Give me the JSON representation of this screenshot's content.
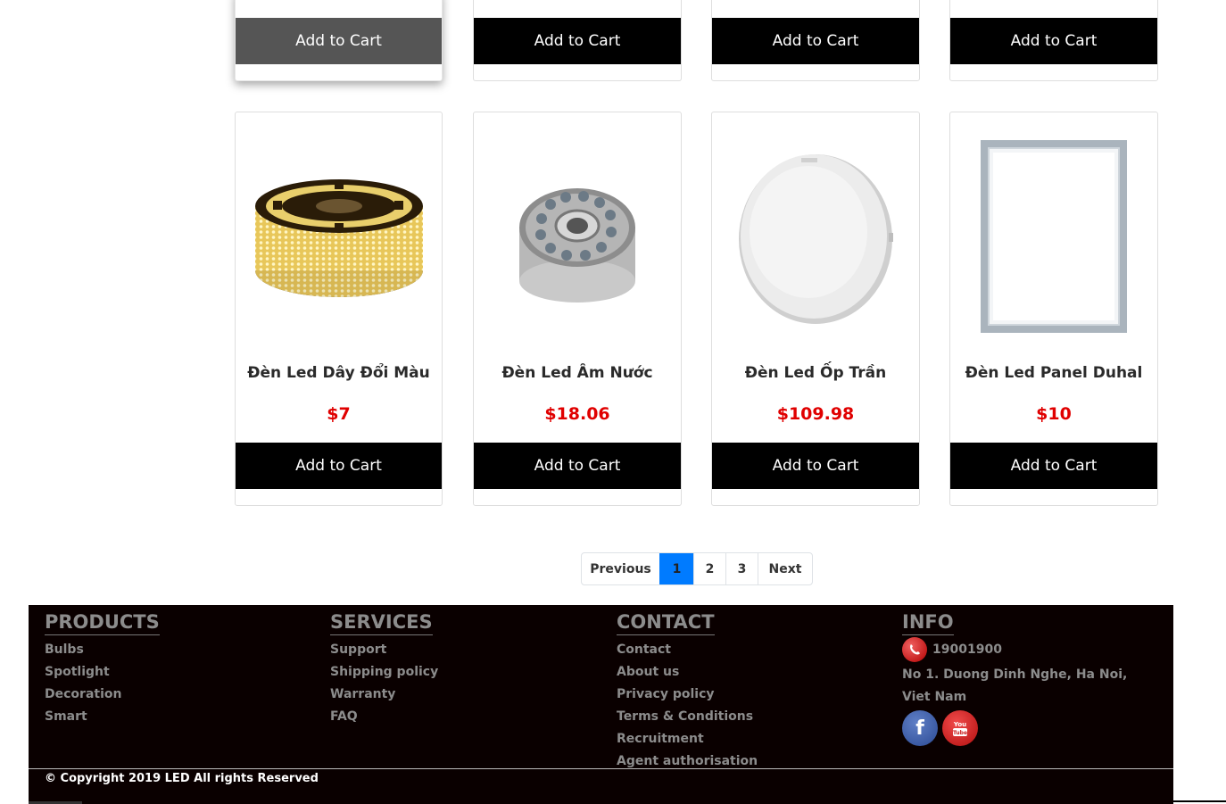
{
  "colors": {
    "price": "#e00000",
    "button_bg": "#000000",
    "button_hover_bg": "#555555",
    "pagination_active": "#007bff",
    "footer_bg": "#0a0000",
    "footer_text": "#8c8c8c"
  },
  "top_row": [
    {
      "cart_label": "Add to Cart",
      "state": "hovered"
    },
    {
      "cart_label": "Add to Cart"
    },
    {
      "cart_label": "Add to Cart"
    },
    {
      "cart_label": "Add to Cart"
    }
  ],
  "products": [
    {
      "name": "Đèn Led Dây Đổi Màu",
      "price": "$7",
      "cart_label": "Add to Cart",
      "image": "led-strip-reel-image"
    },
    {
      "name": "Đèn Led Âm Nước",
      "price": "$18.06",
      "cart_label": "Add to Cart",
      "image": "underwater-led-light-image"
    },
    {
      "name": "Đèn Led Ốp Trần",
      "price": "$109.98",
      "cart_label": "Add to Cart",
      "image": "ceiling-led-light-image"
    },
    {
      "name": "Đèn Led Panel Duhal",
      "price": "$10",
      "cart_label": "Add to Cart",
      "image": "led-panel-image"
    }
  ],
  "pagination": {
    "previous": "Previous",
    "pages": [
      "1",
      "2",
      "3"
    ],
    "active_page": "1",
    "next": "Next"
  },
  "footer": {
    "products": {
      "heading": "PRODUCTS",
      "links": [
        "Bulbs",
        "Spotlight",
        "Decoration",
        "Smart"
      ]
    },
    "services": {
      "heading": "SERVICES",
      "links": [
        "Support",
        "Shipping policy",
        "Warranty",
        "FAQ"
      ]
    },
    "contact": {
      "heading": "CONTACT",
      "links": [
        "Contact",
        "About us",
        "Privacy policy",
        "Terms & Conditions",
        "Recruitment",
        "Agent authorisation"
      ]
    },
    "info": {
      "heading": "INFO",
      "phone": "19001900",
      "address": "No 1. Duong Dinh Nghe, Ha Noi, Viet Nam",
      "icons": [
        "phone-icon",
        "facebook-icon",
        "youtube-icon"
      ]
    },
    "copyright": "© Copyright 2019 LED All rights Reserved"
  }
}
